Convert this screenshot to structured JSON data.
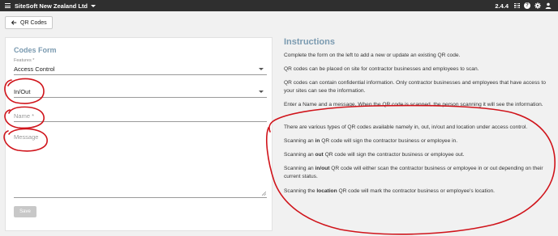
{
  "topbar": {
    "company": "SiteSoft New Zealand Ltd",
    "version": "2.4.4",
    "help_glyph": "?"
  },
  "breadcrumb": {
    "back_label": "QR Codes"
  },
  "form": {
    "title": "Codes Form",
    "features_label": "Features *",
    "features_value": "Access Control",
    "type_value": "In/Out",
    "name_placeholder": "Name *",
    "message_placeholder": "Message",
    "save_label": "Save"
  },
  "instructions": {
    "title": "Instructions",
    "p1": "Complete the form on the left to add a new or update an existing QR code.",
    "p2": "QR codes can be placed on site for contractor businesses and employees to scan.",
    "p3": "QR codes can contain confidential information. Only contractor businesses and employees that have access to your sites can see the information.",
    "p4": "Enter a Name and a message. When the QR code is scanned, the person scanning it will see the information.",
    "p5": "There are various types of QR codes available namely in, out, in/out and location under access control.",
    "p6_pre": "Scanning an ",
    "p6_bold": "in",
    "p6_post": " QR code will sign the contractor business or employee in.",
    "p7_pre": "Scanning an ",
    "p7_bold": "out",
    "p7_post": " QR code will sign the contractor business or employee out.",
    "p8_pre": "Scanning an ",
    "p8_bold": "in/out",
    "p8_post": " QR code will either scan the contractor business or employee in or out depending on their current status.",
    "p9_pre": "Scanning the ",
    "p9_bold": "location",
    "p9_post": " QR code will mark the contractor business or employee's location."
  },
  "colors": {
    "topbar": "#2f2f2f",
    "accent_title": "#7a9ab0",
    "annotation": "#d0141b"
  }
}
